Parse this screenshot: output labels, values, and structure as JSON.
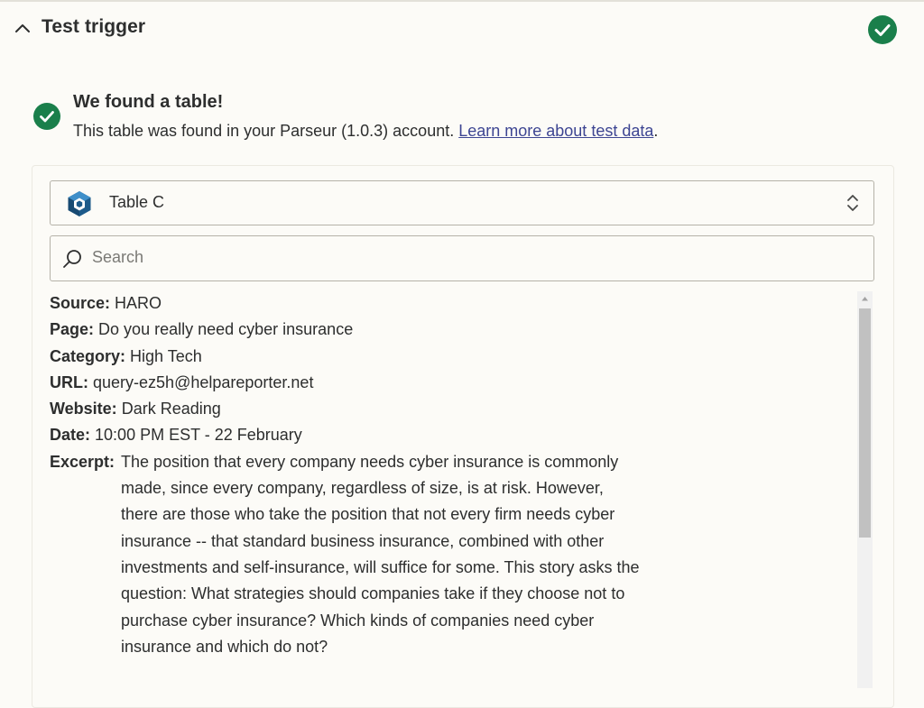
{
  "section": {
    "title": "Test trigger"
  },
  "notice": {
    "title": "We found a table!",
    "desc_prefix": "This table was found in your Parseur (1.0.3) account. ",
    "link_text": "Learn more about test data",
    "desc_suffix": "."
  },
  "table_select": {
    "label": "Table C"
  },
  "search": {
    "placeholder": "Search",
    "value": ""
  },
  "record": {
    "source_key": "Source:",
    "source_value": "HARO",
    "page_key": "Page:",
    "page_value": "Do you really need cyber insurance",
    "category_key": "Category:",
    "category_value": "High Tech",
    "url_key": "URL:",
    "url_value": "query-ez5h@helpareporter.net",
    "website_key": "Website:",
    "website_value": "Dark Reading",
    "date_key": "Date:",
    "date_value": "10:00 PM EST - 22 February",
    "excerpt_key": "Excerpt:",
    "excerpt_value": "The position that every company needs cyber insurance is commonly made, since every company, regardless of size, is at risk. However, there are those who take the position that not every firm needs cyber insurance -- that standard business insurance, combined with other investments and self-insurance, will suffice for some. This story asks the question: What strategies should companies take if they choose not to purchase cyber insurance? Which kinds of companies need cyber insurance and which do not?"
  },
  "colors": {
    "success_green": "#1a7f4b",
    "link_blue": "#3d4592",
    "background": "#fcfbf7",
    "brand_logo": "#1c5a8a"
  },
  "icons": {
    "collapse": "chevron-up-icon",
    "status": "check-circle-icon",
    "app_logo": "parseur-logo-icon",
    "select": "up-down-chevron-icon",
    "search": "search-icon"
  }
}
